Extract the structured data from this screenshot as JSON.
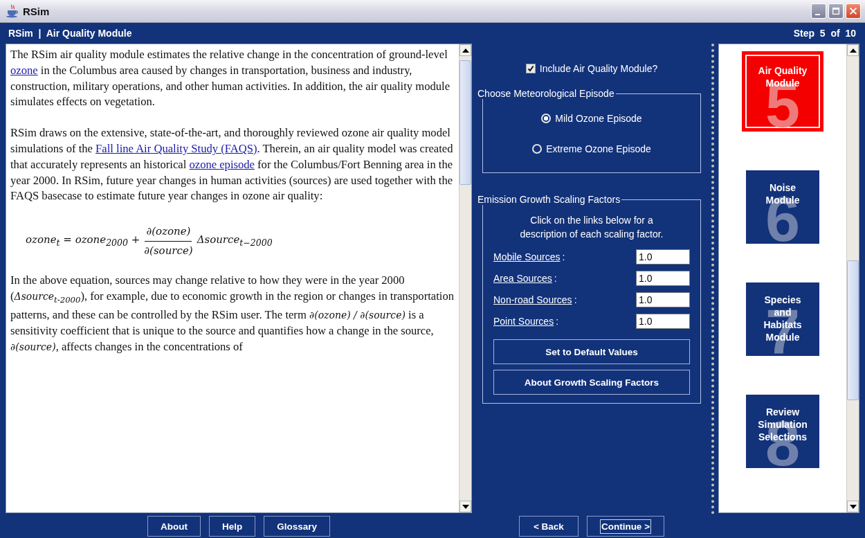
{
  "window": {
    "title": "RSim"
  },
  "header": {
    "title": "RSim  |  Air Quality Module",
    "step": "Step  5  of  10"
  },
  "article": {
    "paragraphs": [
      {
        "kind": "text",
        "segments": [
          {
            "kind": "text",
            "text": "The RSim air quality module estimates the relative change in the concentration of ground-level "
          },
          {
            "kind": "link",
            "text": "ozone"
          },
          {
            "kind": "text",
            "text": " in the Columbus area caused by changes in transportation, business and industry, construction, military operations, and other human activities. In addition, the air quality module simulates effects on vegetation."
          }
        ]
      },
      {
        "kind": "text",
        "segments": [
          {
            "kind": "text",
            "text": "RSim draws on the extensive, state-of-the-art, and thoroughly reviewed ozone air quality model simulations of the "
          },
          {
            "kind": "link",
            "text": "Fall line Air Quality Study (FAQS)"
          },
          {
            "kind": "text",
            "text": ". Therein, an air quality model was created that accurately represents an historical "
          },
          {
            "kind": "link",
            "text": "ozone episode"
          },
          {
            "kind": "text",
            "text": " for the Columbus/Fort Benning area in the year 2000. In RSim, future year changes in human activities (sources) are used together with the FAQS basecase to estimate future year changes in ozone air quality:"
          }
        ]
      },
      {
        "kind": "equation",
        "left": "ozone$_{t}$ = ozone$_{2000}$ +",
        "numerator": "∂(ozone)",
        "denominator": "∂(source)",
        "right": "Δsource$_{t−2000}$"
      },
      {
        "kind": "text",
        "segments": [
          {
            "kind": "text",
            "text": "In the above equation, sources may change relative to how they were in the year 2000 ("
          },
          {
            "kind": "math",
            "text": "Δsource$_{t-2000}$"
          },
          {
            "kind": "text",
            "text": "), for example, due to economic growth in the region or changes in transportation patterns, and these can be controlled by the RSim user. The term "
          },
          {
            "kind": "math",
            "text": "∂(ozone) / ∂(source)"
          },
          {
            "kind": "text",
            "text": " is a sensitivity coefficient that is unique to the source and quantifies how a change in the source, "
          },
          {
            "kind": "math",
            "text": "∂(source)"
          },
          {
            "kind": "text",
            "text": ", affects changes in the concentrations of"
          }
        ]
      }
    ]
  },
  "include_module": {
    "label": "Include Air Quality Module?",
    "checked": true
  },
  "episode": {
    "title": "Choose Meteorological Episode",
    "options": [
      {
        "label": "Mild Ozone Episode",
        "selected": true
      },
      {
        "label": "Extreme Ozone Episode",
        "selected": false
      }
    ]
  },
  "scaling": {
    "title": "Emission Growth Scaling Factors",
    "description": "Click on the links below for a description of each scaling factor.",
    "factors": [
      {
        "label": "Mobile Sources",
        "separator": ":",
        "value": "1.0"
      },
      {
        "label": "Area Sources",
        "separator": ":",
        "value": "1.0"
      },
      {
        "label": "Non-road Sources",
        "separator": ":",
        "value": "1.0"
      },
      {
        "label": "Point Sources",
        "separator": ":",
        "value": "1.0"
      }
    ],
    "buttons": [
      "Set to Default Values",
      "About Growth Scaling Factors"
    ]
  },
  "modules": [
    {
      "number": "5",
      "label": "Air Quality Module",
      "selected": true
    },
    {
      "number": "6",
      "label": "Noise Module",
      "selected": false
    },
    {
      "number": "7",
      "label": "Species and Habitats Module",
      "selected": false
    },
    {
      "number": "8",
      "label": "Review Simulation Selections",
      "selected": false
    }
  ],
  "footer": {
    "left_buttons": [
      "About",
      "Help",
      "Glossary"
    ],
    "right_buttons": [
      {
        "label": "< Back",
        "focused": false
      },
      {
        "label": "Continue >",
        "focused": true
      }
    ]
  }
}
